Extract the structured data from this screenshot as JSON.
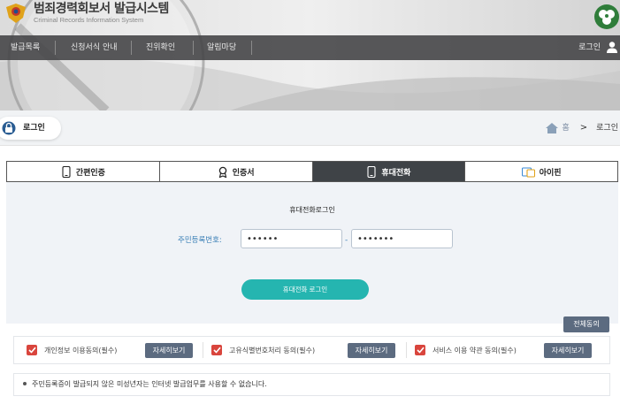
{
  "header": {
    "title": "범죄경력회보서 발급시스템",
    "subtitle": "Criminal Records Information System"
  },
  "nav": {
    "items": [
      "발급목록",
      "신청서식 안내",
      "진위확인",
      "알림마당"
    ],
    "login_label": "로그인"
  },
  "breadcrumb": {
    "page_title": "로그인",
    "home": "홈",
    "separator": ">",
    "current": "로그인"
  },
  "tabs": [
    {
      "label": "간편인증",
      "icon": "phone-icon",
      "active": false
    },
    {
      "label": "인증서",
      "icon": "certificate-icon",
      "active": false
    },
    {
      "label": "휴대전화",
      "icon": "phone-icon",
      "active": true
    },
    {
      "label": "아이핀",
      "icon": "ipin-card-icon",
      "active": false
    }
  ],
  "login": {
    "title": "휴대전화로그인",
    "rrn_label": "주민등록번호:",
    "rrn_front_value": "••••••",
    "rrn_dash": "-",
    "rrn_back_value": "•••••••",
    "submit_label": "휴대전화 로그인"
  },
  "agreements": {
    "agree_all_label": "전체동의",
    "items": [
      {
        "label": "개인정보 이용동의(필수)",
        "checked": true
      },
      {
        "label": "고유식별번호처리 동의(필수)",
        "checked": true
      },
      {
        "label": "서비스 이용 약관 동의(필수)",
        "checked": true
      }
    ],
    "detail_label": "자세히보기"
  },
  "notice": "주민등록증이 발급되지 않은 미성년자는 인터넷 발급업무를 사용할 수 없습니다.",
  "colors": {
    "accent_teal": "#25b5b0",
    "nav_bg": "#464648",
    "check_red": "#d9453d",
    "button_slate": "#5c6b80",
    "active_tab": "#3f4347",
    "label_blue": "#3a7fb6"
  }
}
